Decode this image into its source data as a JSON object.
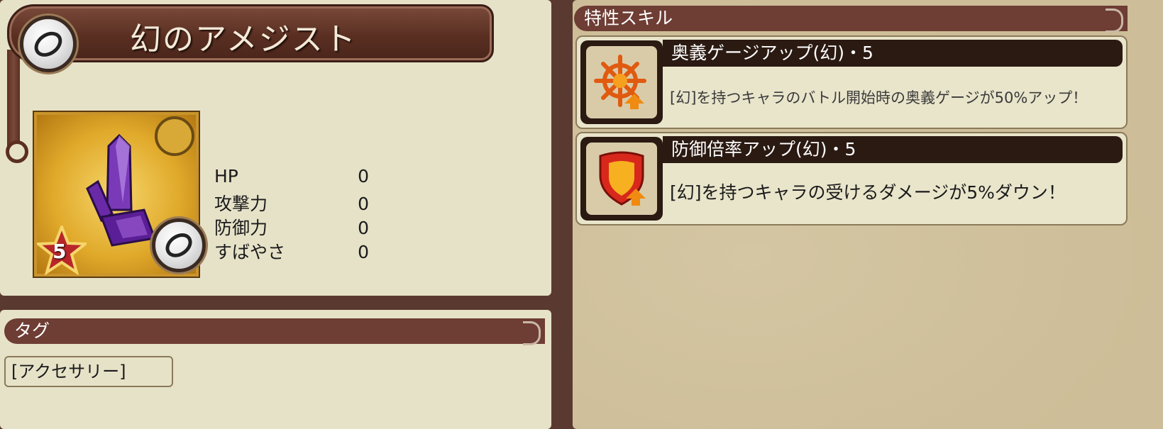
{
  "item": {
    "name": "幻のアメジスト",
    "rarity": "5",
    "icon": "ring-icon",
    "image": "amethyst-crystal"
  },
  "stats": [
    {
      "label": "HP",
      "value": "0"
    },
    {
      "label": "攻撃力",
      "value": "0"
    },
    {
      "label": "防御力",
      "value": "0"
    },
    {
      "label": "すばやさ",
      "value": "0"
    }
  ],
  "tags": {
    "header": "タグ",
    "items": [
      "[アクセサリー]"
    ]
  },
  "skills": {
    "header": "特性スキル",
    "items": [
      {
        "title": "奥義ゲージアップ(幻)・5",
        "description": "[幻]を持つキャラのバトル開始時の奥義ゲージが50%アップ！",
        "icon": "star-burst-icon"
      },
      {
        "title": "防御倍率アップ(幻)・5",
        "description": "[幻]を持つキャラの受けるダメージが5%ダウン！",
        "icon": "shield-icon"
      }
    ]
  },
  "colors": {
    "panel": "#e6e2c8",
    "header": "#6e3d34",
    "skill_title_bg": "#2a1a12",
    "right_bg": "#d1c19b"
  }
}
